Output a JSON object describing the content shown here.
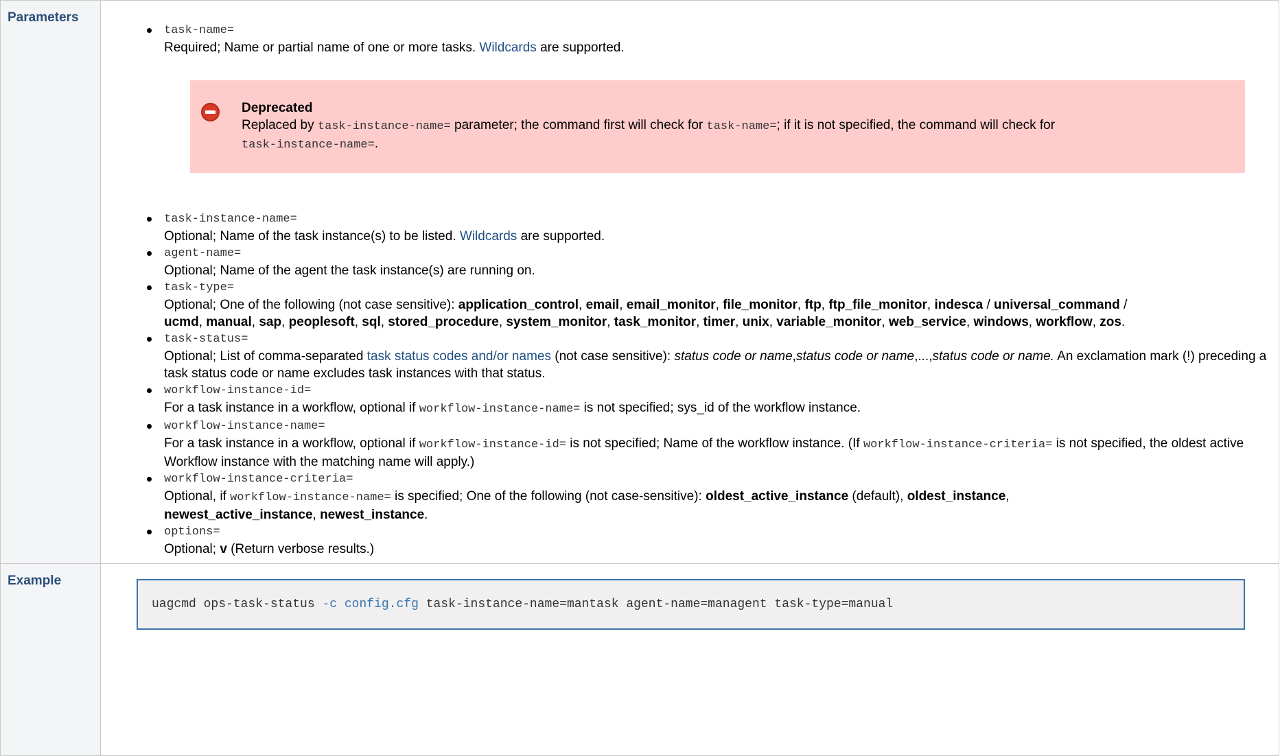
{
  "rows": {
    "parameters_label": "Parameters",
    "example_label": "Example"
  },
  "params": [
    {
      "name": "task-name=",
      "desc_pre": "Required; Name or partial name of one or more tasks. ",
      "link": "Wildcards",
      "desc_post": " are supported."
    },
    {
      "name": "task-instance-name=",
      "desc_pre": "Optional; Name of the task instance(s) to be listed. ",
      "link": "Wildcards",
      "desc_post": " are supported."
    },
    {
      "name": "agent-name=",
      "desc": "Optional; Name of the agent the task instance(s) are running on."
    },
    {
      "name": "task-type=",
      "desc_pre": "Optional; One of the following (not case sensitive): ",
      "types": [
        "application_control",
        "email",
        "email_monitor",
        "file_monitor",
        "ftp",
        "ftp_file_monitor",
        "indesca",
        "universal_command",
        "ucmd",
        "manual",
        "sap",
        "peoplesoft",
        "sql",
        "stored_procedure",
        "system_monitor",
        "task_monitor",
        "timer",
        "unix",
        "variable_monitor",
        "web_service",
        "windows",
        "workflow",
        "zos"
      ]
    },
    {
      "name": "task-status=",
      "desc_pre": "Optional; List of comma-separated ",
      "link": "task status codes and/or names",
      "desc_mid": " (not case sensitive): ",
      "italic1": "status code or name",
      "sep1": ",",
      "italic2": "status code or name",
      "sep2": ",...,",
      "italic3": "status code or name.",
      "desc_post": " An exclamation mark (!) preceding a task status code or name excludes task instances with that status."
    },
    {
      "name": "workflow-instance-id=",
      "desc_pre": "For a task instance in a workflow, optional if ",
      "code": "workflow-instance-name=",
      "desc_post": " is not specified; sys_id of the workflow instance."
    },
    {
      "name": "workflow-instance-name=",
      "desc_pre": "For a task instance in a workflow, optional if ",
      "code": "workflow-instance-id=",
      "desc_mid": " is not specified; Name of the workflow instance. (If ",
      "code2": "workflow-instance-criteria=",
      "desc_post": " is not specified, the oldest active Workflow instance with the matching name will apply.)"
    },
    {
      "name": "workflow-instance-criteria=",
      "desc_pre": "Optional, if ",
      "code": "workflow-instance-name=",
      "desc_mid": " is specified; One of the following (not case-sensitive): ",
      "b1": "oldest_active_instance",
      "mid2": " (default), ",
      "b2": "oldest_instance",
      "sep": ", ",
      "b3": "newest_active_instance",
      "sep2": ", ",
      "b4": "newest_instance",
      "end": "."
    },
    {
      "name": "options=",
      "desc_pre": "Optional; ",
      "b1": "v",
      "desc_post": " (Return verbose results.)"
    }
  ],
  "notice": {
    "title": "Deprecated",
    "pre": "Replaced by ",
    "code1": "task-instance-name=",
    "mid": " parameter; the command first will check for ",
    "code2": "task-name=",
    "mid2": "; if it is not specified, the command will check for ",
    "code3": "task-instance-name=",
    "end": "."
  },
  "example": {
    "cmd": "uagcmd ops-task-status ",
    "opt": "-c",
    "space": " ",
    "cfg": "config.cfg",
    "rest": " task-instance-name=mantask agent-name=managent task-type=manual"
  }
}
